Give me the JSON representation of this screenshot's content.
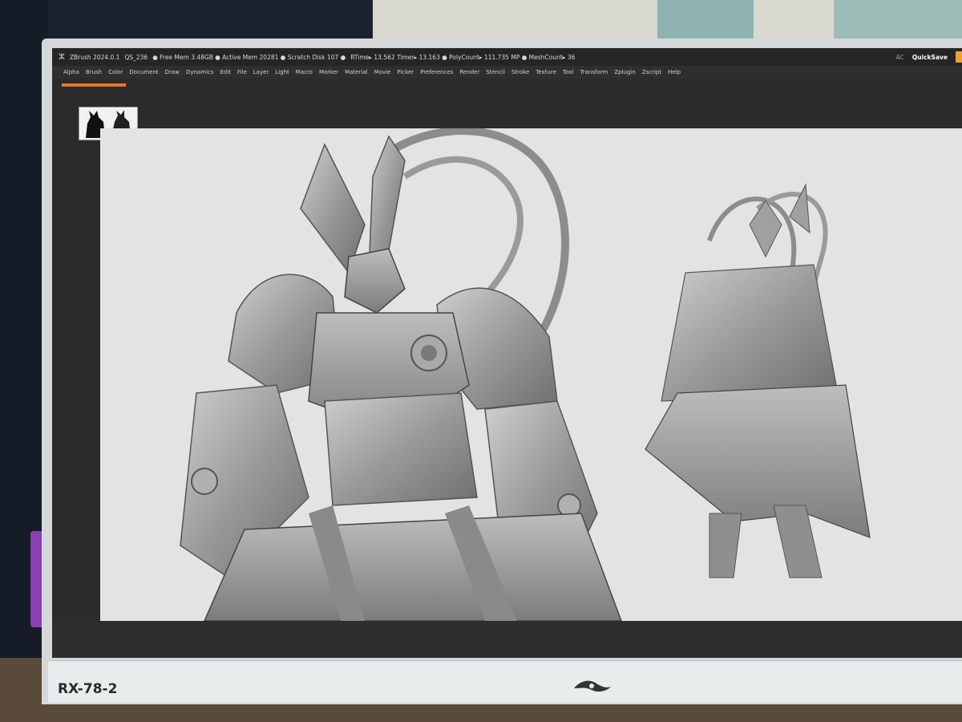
{
  "app": {
    "version": "ZBrush 2024.0.1",
    "status_items": [
      "QS_236",
      "● Free Mem 3.48GB ● Active Mem 20281 ● Scratch Disk 107 ●",
      "RTime▸ 13.562 Timer▸ 13.163 ● PolyCount▸ 111.735 MP ● MeshCount▸ 36"
    ],
    "ac_label": "AC",
    "quicksave_label": "QuickSave"
  },
  "menu": [
    "Alpha",
    "Brush",
    "Color",
    "Document",
    "Draw",
    "Dynamics",
    "Edit",
    "File",
    "Layer",
    "Light",
    "Macro",
    "Marker",
    "Material",
    "Movie",
    "Picker",
    "Preferences",
    "Render",
    "Stencil",
    "Stroke",
    "Texture",
    "Tool",
    "Transform",
    "Zplugin",
    "Zscript",
    "Help"
  ],
  "monitor": {
    "model": "RX-78-2"
  },
  "colors": {
    "accent": "#e8782a",
    "canvas_bg": "#e4e2e2",
    "ui_bg": "#2b2b2b"
  }
}
